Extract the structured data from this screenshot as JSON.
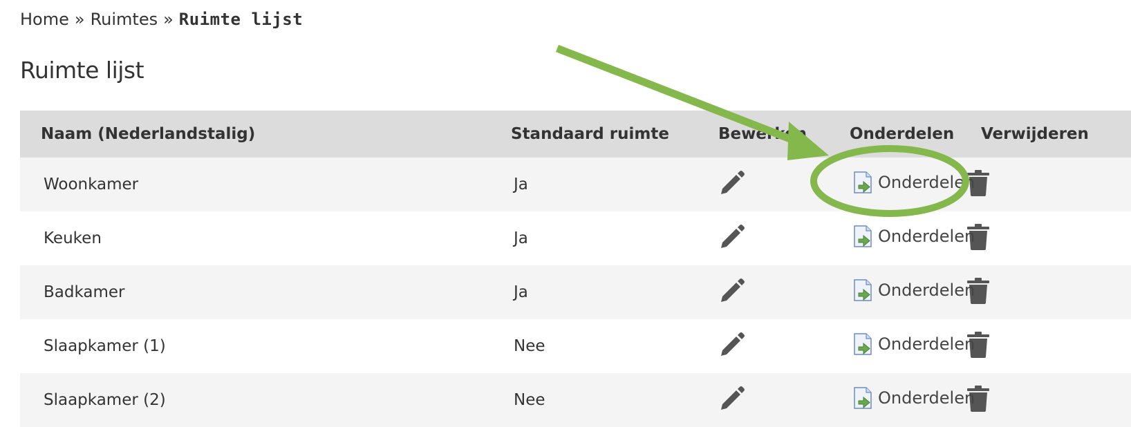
{
  "breadcrumb": {
    "home": "Home",
    "separator": "»",
    "section": "Ruimtes",
    "current": "Ruimte lijst"
  },
  "page": {
    "title": "Ruimte lijst"
  },
  "table": {
    "headers": {
      "name": "Naam (Nederlandstalig)",
      "standard": "Standaard ruimte",
      "edit": "Bewerken",
      "parts": "Onderdelen",
      "delete": "Verwijderen"
    },
    "rows": [
      {
        "name": "Woonkamer",
        "standard": "Ja",
        "parts_label": "Onderdelen"
      },
      {
        "name": "Keuken",
        "standard": "Ja",
        "parts_label": "Onderdelen"
      },
      {
        "name": "Badkamer",
        "standard": "Ja",
        "parts_label": "Onderdelen"
      },
      {
        "name": "Slaapkamer (1)",
        "standard": "Nee",
        "parts_label": "Onderdelen"
      },
      {
        "name": "Slaapkamer (2)",
        "standard": "Nee",
        "parts_label": "Onderdelen"
      }
    ]
  },
  "icons": {
    "edit": "pencil-icon",
    "parts": "document-arrow-icon",
    "delete": "trash-icon"
  },
  "colors": {
    "header_bg": "#dcdcdc",
    "row_odd_bg": "#f4f4f4",
    "icon_gray": "#555555",
    "annotation_green": "#84b84c"
  }
}
